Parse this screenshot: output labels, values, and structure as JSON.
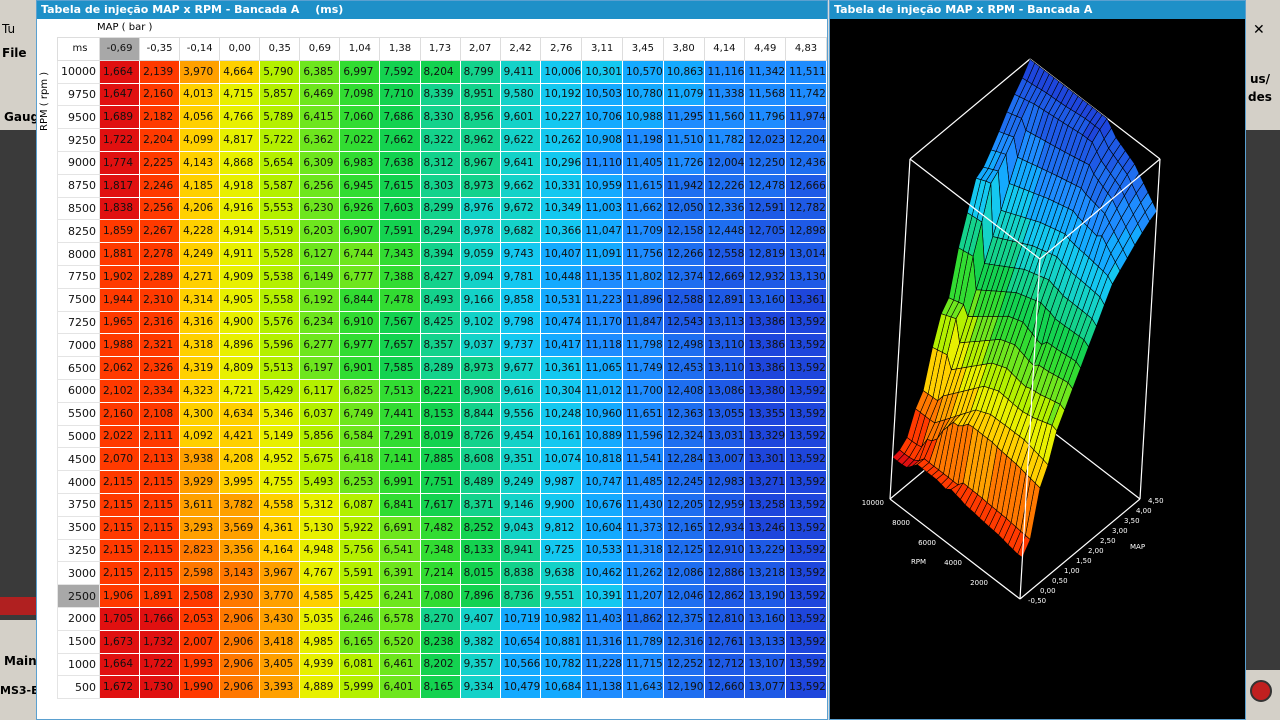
{
  "background": {
    "window_title": "Tu",
    "menu_file": "File",
    "gauge_tab": "Gaug",
    "main_tab": "Main",
    "status_label": "MS3-E",
    "right_button_line1": "us/",
    "right_button_line2": "des",
    "close_glyph": "✕"
  },
  "table_window": {
    "title": "Tabela de injeção MAP x RPM - Bancada A",
    "unit": "(ms)",
    "x_axis_caption": "MAP    ( bar )",
    "y_axis_caption": "RPM   ( rpm )",
    "corner_label": "ms",
    "selected_col": 0,
    "selected_row": 23,
    "map_values": [
      "-0,69",
      "-0,35",
      "-0,14",
      "0,00",
      "0,35",
      "0,69",
      "1,04",
      "1,38",
      "1,73",
      "2,07",
      "2,42",
      "2,76",
      "3,11",
      "3,45",
      "3,80",
      "4,14",
      "4,49",
      "4,83"
    ],
    "rows": [
      {
        "rpm": "10000",
        "v": [
          "1,664",
          "2,139",
          "3,970",
          "4,664",
          "5,790",
          "6,385",
          "6,997",
          "7,592",
          "8,204",
          "8,799",
          "9,411",
          "10,006",
          "10,301",
          "10,570",
          "10,863",
          "11,116",
          "11,342",
          "11,511"
        ]
      },
      {
        "rpm": "9750",
        "v": [
          "1,647",
          "2,160",
          "4,013",
          "4,715",
          "5,857",
          "6,469",
          "7,098",
          "7,710",
          "8,339",
          "8,951",
          "9,580",
          "10,192",
          "10,503",
          "10,780",
          "11,079",
          "11,338",
          "11,568",
          "11,742"
        ]
      },
      {
        "rpm": "9500",
        "v": [
          "1,689",
          "2,182",
          "4,056",
          "4,766",
          "5,789",
          "6,415",
          "7,060",
          "7,686",
          "8,330",
          "8,956",
          "9,601",
          "10,227",
          "10,706",
          "10,988",
          "11,295",
          "11,560",
          "11,796",
          "11,974"
        ]
      },
      {
        "rpm": "9250",
        "v": [
          "1,722",
          "2,204",
          "4,099",
          "4,817",
          "5,722",
          "6,362",
          "7,022",
          "7,662",
          "8,322",
          "8,962",
          "9,622",
          "10,262",
          "10,908",
          "11,198",
          "11,510",
          "11,782",
          "12,023",
          "12,204"
        ]
      },
      {
        "rpm": "9000",
        "v": [
          "1,774",
          "2,225",
          "4,143",
          "4,868",
          "5,654",
          "6,309",
          "6,983",
          "7,638",
          "8,312",
          "8,967",
          "9,641",
          "10,296",
          "11,110",
          "11,405",
          "11,726",
          "12,004",
          "12,250",
          "12,436"
        ]
      },
      {
        "rpm": "8750",
        "v": [
          "1,817",
          "2,246",
          "4,185",
          "4,918",
          "5,587",
          "6,256",
          "6,945",
          "7,615",
          "8,303",
          "8,973",
          "9,662",
          "10,331",
          "10,959",
          "11,615",
          "11,942",
          "12,226",
          "12,478",
          "12,666"
        ]
      },
      {
        "rpm": "8500",
        "v": [
          "1,838",
          "2,256",
          "4,206",
          "4,916",
          "5,553",
          "6,230",
          "6,926",
          "7,603",
          "8,299",
          "8,976",
          "9,672",
          "10,349",
          "11,003",
          "11,662",
          "12,050",
          "12,336",
          "12,591",
          "12,782"
        ]
      },
      {
        "rpm": "8250",
        "v": [
          "1,859",
          "2,267",
          "4,228",
          "4,914",
          "5,519",
          "6,203",
          "6,907",
          "7,591",
          "8,294",
          "8,978",
          "9,682",
          "10,366",
          "11,047",
          "11,709",
          "12,158",
          "12,448",
          "12,705",
          "12,898"
        ]
      },
      {
        "rpm": "8000",
        "v": [
          "1,881",
          "2,278",
          "4,249",
          "4,911",
          "5,528",
          "6,127",
          "6,744",
          "7,343",
          "8,394",
          "9,059",
          "9,743",
          "10,407",
          "11,091",
          "11,756",
          "12,266",
          "12,558",
          "12,819",
          "13,014"
        ]
      },
      {
        "rpm": "7750",
        "v": [
          "1,902",
          "2,289",
          "4,271",
          "4,909",
          "5,538",
          "6,149",
          "6,777",
          "7,388",
          "8,427",
          "9,094",
          "9,781",
          "10,448",
          "11,135",
          "11,802",
          "12,374",
          "12,669",
          "12,932",
          "13,130"
        ]
      },
      {
        "rpm": "7500",
        "v": [
          "1,944",
          "2,310",
          "4,314",
          "4,905",
          "5,558",
          "6,192",
          "6,844",
          "7,478",
          "8,493",
          "9,166",
          "9,858",
          "10,531",
          "11,223",
          "11,896",
          "12,588",
          "12,891",
          "13,160",
          "13,361"
        ]
      },
      {
        "rpm": "7250",
        "v": [
          "1,965",
          "2,316",
          "4,316",
          "4,900",
          "5,576",
          "6,234",
          "6,910",
          "7,567",
          "8,425",
          "9,102",
          "9,798",
          "10,474",
          "11,170",
          "11,847",
          "12,543",
          "13,113",
          "13,386",
          "13,592"
        ]
      },
      {
        "rpm": "7000",
        "v": [
          "1,988",
          "2,321",
          "4,318",
          "4,896",
          "5,596",
          "6,277",
          "6,977",
          "7,657",
          "8,357",
          "9,037",
          "9,737",
          "10,417",
          "11,118",
          "11,798",
          "12,498",
          "13,110",
          "13,386",
          "13,592"
        ]
      },
      {
        "rpm": "6500",
        "v": [
          "2,062",
          "2,326",
          "4,319",
          "4,809",
          "5,513",
          "6,197",
          "6,901",
          "7,585",
          "8,289",
          "8,973",
          "9,677",
          "10,361",
          "11,065",
          "11,749",
          "12,453",
          "13,110",
          "13,386",
          "13,592"
        ]
      },
      {
        "rpm": "6000",
        "v": [
          "2,102",
          "2,334",
          "4,323",
          "4,721",
          "5,429",
          "6,117",
          "6,825",
          "7,513",
          "8,221",
          "8,908",
          "9,616",
          "10,304",
          "11,012",
          "11,700",
          "12,408",
          "13,086",
          "13,380",
          "13,592"
        ]
      },
      {
        "rpm": "5500",
        "v": [
          "2,160",
          "2,108",
          "4,300",
          "4,634",
          "5,346",
          "6,037",
          "6,749",
          "7,441",
          "8,153",
          "8,844",
          "9,556",
          "10,248",
          "10,960",
          "11,651",
          "12,363",
          "13,055",
          "13,355",
          "13,592"
        ]
      },
      {
        "rpm": "5000",
        "v": [
          "2,022",
          "2,111",
          "4,092",
          "4,421",
          "5,149",
          "5,856",
          "6,584",
          "7,291",
          "8,019",
          "8,726",
          "9,454",
          "10,161",
          "10,889",
          "11,596",
          "12,324",
          "13,031",
          "13,329",
          "13,592"
        ]
      },
      {
        "rpm": "4500",
        "v": [
          "2,070",
          "2,113",
          "3,938",
          "4,208",
          "4,952",
          "5,675",
          "6,418",
          "7,141",
          "7,885",
          "8,608",
          "9,351",
          "10,074",
          "10,818",
          "11,541",
          "12,284",
          "13,007",
          "13,301",
          "13,592"
        ]
      },
      {
        "rpm": "4000",
        "v": [
          "2,115",
          "2,115",
          "3,929",
          "3,995",
          "4,755",
          "5,493",
          "6,253",
          "6,991",
          "7,751",
          "8,489",
          "9,249",
          "9,987",
          "10,747",
          "11,485",
          "12,245",
          "12,983",
          "13,271",
          "13,592"
        ]
      },
      {
        "rpm": "3750",
        "v": [
          "2,115",
          "2,115",
          "3,611",
          "3,782",
          "4,558",
          "5,312",
          "6,087",
          "6,841",
          "7,617",
          "8,371",
          "9,146",
          "9,900",
          "10,676",
          "11,430",
          "12,205",
          "12,959",
          "13,258",
          "13,592"
        ]
      },
      {
        "rpm": "3500",
        "v": [
          "2,115",
          "2,115",
          "3,293",
          "3,569",
          "4,361",
          "5,130",
          "5,922",
          "6,691",
          "7,482",
          "8,252",
          "9,043",
          "9,812",
          "10,604",
          "11,373",
          "12,165",
          "12,934",
          "13,246",
          "13,592"
        ]
      },
      {
        "rpm": "3250",
        "v": [
          "2,115",
          "2,115",
          "2,823",
          "3,356",
          "4,164",
          "4,948",
          "5,756",
          "6,541",
          "7,348",
          "8,133",
          "8,941",
          "9,725",
          "10,533",
          "11,318",
          "12,125",
          "12,910",
          "13,229",
          "13,592"
        ]
      },
      {
        "rpm": "3000",
        "v": [
          "2,115",
          "2,115",
          "2,598",
          "3,143",
          "3,967",
          "4,767",
          "5,591",
          "6,391",
          "7,214",
          "8,015",
          "8,838",
          "9,638",
          "10,462",
          "11,262",
          "12,086",
          "12,886",
          "13,218",
          "13,592"
        ]
      },
      {
        "rpm": "2500",
        "v": [
          "1,906",
          "1,891",
          "2,508",
          "2,930",
          "3,770",
          "4,585",
          "5,425",
          "6,241",
          "7,080",
          "7,896",
          "8,736",
          "9,551",
          "10,391",
          "11,207",
          "12,046",
          "12,862",
          "13,190",
          "13,592"
        ]
      },
      {
        "rpm": "2000",
        "v": [
          "1,705",
          "1,766",
          "2,053",
          "2,906",
          "3,430",
          "5,035",
          "6,246",
          "6,578",
          "8,270",
          "9,407",
          "10,719",
          "10,982",
          "11,403",
          "11,862",
          "12,375",
          "12,810",
          "13,160",
          "13,592"
        ]
      },
      {
        "rpm": "1500",
        "v": [
          "1,673",
          "1,732",
          "2,007",
          "2,906",
          "3,418",
          "4,985",
          "6,165",
          "6,520",
          "8,238",
          "9,382",
          "10,654",
          "10,881",
          "11,316",
          "11,789",
          "12,316",
          "12,761",
          "13,133",
          "13,592"
        ]
      },
      {
        "rpm": "1000",
        "v": [
          "1,664",
          "1,722",
          "1,993",
          "2,906",
          "3,405",
          "4,939",
          "6,081",
          "6,461",
          "8,202",
          "9,357",
          "10,566",
          "10,782",
          "11,228",
          "11,715",
          "12,252",
          "12,712",
          "13,107",
          "13,592"
        ]
      },
      {
        "rpm": "500",
        "v": [
          "1,672",
          "1,730",
          "1,990",
          "2,906",
          "3,393",
          "4,889",
          "5,999",
          "6,401",
          "8,165",
          "9,334",
          "10,479",
          "10,684",
          "11,138",
          "11,643",
          "12,190",
          "12,660",
          "13,077",
          "13,592"
        ]
      }
    ],
    "color_ramp": [
      "#e01010",
      "#ff3a00",
      "#ff7800",
      "#ffa000",
      "#ffd000",
      "#e8f000",
      "#b4f000",
      "#6ee61e",
      "#32dc32",
      "#14d250",
      "#14d28c",
      "#14d2c8",
      "#14c8f0",
      "#14aaff",
      "#1e8cff",
      "#1e6ef0",
      "#1e5ae6",
      "#1e46dc"
    ],
    "value_min": 1.5,
    "value_max": 13.6
  },
  "view_window": {
    "title": "Tabela de injeção MAP x RPM - Bancada A",
    "rpm_axis_label": "RPM",
    "map_axis_label": "MAP",
    "rpm_ticks": [
      "10000",
      "8000",
      "6000",
      "4000",
      "2000"
    ],
    "map_ticks": [
      "4,50",
      "4,00",
      "3,50",
      "3,00",
      "2,50",
      "2,00",
      "1,50",
      "1,00",
      "0,50",
      "0,00",
      "-0,50"
    ]
  }
}
